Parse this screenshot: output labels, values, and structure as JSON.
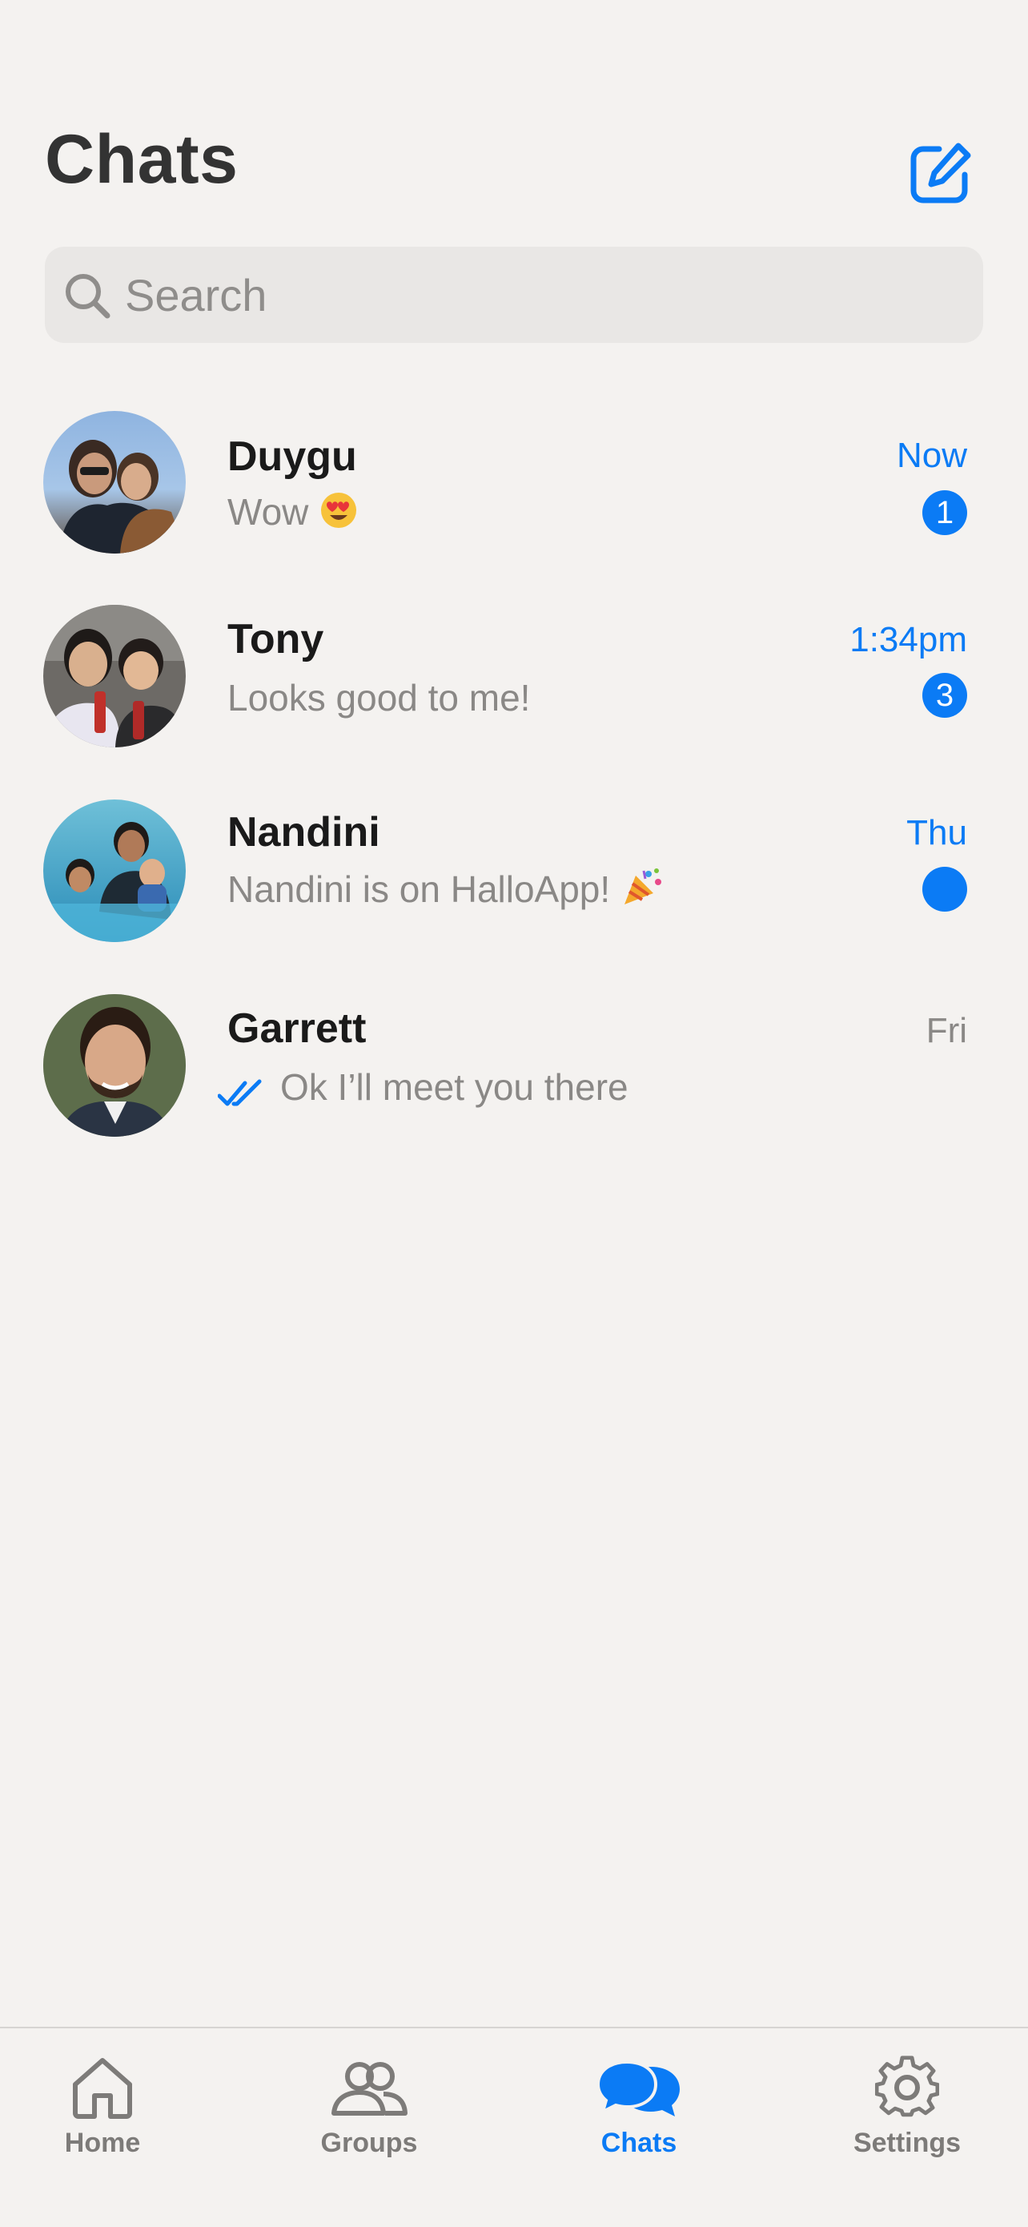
{
  "header": {
    "title": "Chats"
  },
  "search": {
    "placeholder": "Search",
    "value": ""
  },
  "icons": {
    "compose": "compose-icon",
    "search": "search-icon",
    "read_receipt": "double-check-icon"
  },
  "colors": {
    "accent": "#0b7bf5",
    "background": "#f4f2f0",
    "search_background": "#e9e7e5",
    "muted_text": "#8a8886"
  },
  "chats": [
    {
      "name": "Duygu",
      "preview": "Wow",
      "emoji": "heart-eyes-emoji",
      "time": "Now",
      "time_highlighted": true,
      "badge": "1"
    },
    {
      "name": "Tony",
      "preview": "Looks good to me!",
      "time": "1:34pm",
      "time_highlighted": true,
      "badge": "3"
    },
    {
      "name": "Nandini",
      "preview": "Nandini is on HalloApp!",
      "emoji": "party-popper-emoji",
      "time": "Thu",
      "time_highlighted": true,
      "badge": ""
    },
    {
      "name": "Garrett",
      "preview": "Ok I’ll meet you there",
      "time": "Fri",
      "time_highlighted": false,
      "read_receipt": true
    }
  ],
  "tabs": [
    {
      "label": "Home",
      "icon": "home-icon",
      "active": false
    },
    {
      "label": "Groups",
      "icon": "groups-icon",
      "active": false
    },
    {
      "label": "Chats",
      "icon": "chats-icon",
      "active": true
    },
    {
      "label": "Settings",
      "icon": "settings-icon",
      "active": false
    }
  ]
}
